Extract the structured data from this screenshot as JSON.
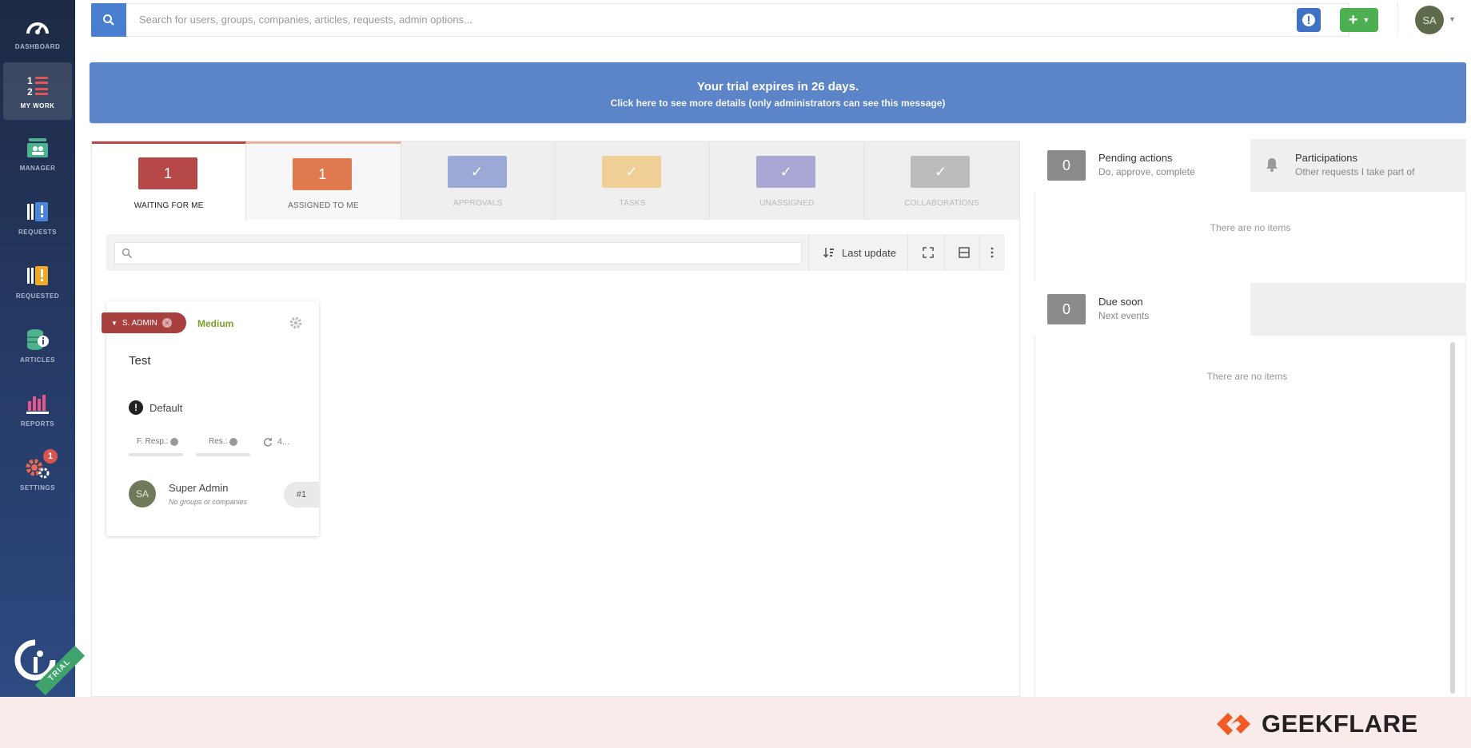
{
  "sidebar": {
    "items": [
      {
        "label": "DASHBOARD",
        "icon": "gauge-icon"
      },
      {
        "label": "MY WORK",
        "icon": "numbered-list-icon"
      },
      {
        "label": "MANAGER",
        "icon": "manager-icon"
      },
      {
        "label": "REQUESTS",
        "icon": "requests-icon"
      },
      {
        "label": "REQUESTED",
        "icon": "requested-icon"
      },
      {
        "label": "ARTICLES",
        "icon": "database-info-icon"
      },
      {
        "label": "REPORTS",
        "icon": "bar-chart-icon"
      },
      {
        "label": "SETTINGS",
        "icon": "gears-icon",
        "badge": "1"
      }
    ],
    "trial_label": "TRIAL"
  },
  "topbar": {
    "search_placeholder": "Search for users, groups, companies, articles, requests, admin options...",
    "avatar_initials": "SA"
  },
  "banner": {
    "line1": "Your trial expires in 26 days.",
    "line2": "Click here to see more details (only administrators can see this message)"
  },
  "tabs": [
    {
      "label": "WAITING FOR ME",
      "value": "1",
      "color": "#b74848"
    },
    {
      "label": "ASSIGNED TO ME",
      "value": "1",
      "color": "#e07a4e"
    },
    {
      "label": "APPROVALS",
      "value": "✓",
      "color": "#9aa9d6"
    },
    {
      "label": "TASKS",
      "value": "✓",
      "color": "#f0cf96"
    },
    {
      "label": "UNASSIGNED",
      "value": "✓",
      "color": "#a9a7d4"
    },
    {
      "label": "COLLABORATIONS",
      "value": "✓",
      "color": "#bcbcbc"
    }
  ],
  "toolbar": {
    "sort_label": "Last update"
  },
  "card": {
    "owner": "S. ADMIN",
    "priority": "Medium",
    "title": "Test",
    "category": "Default",
    "first_response": "F. Resp.:",
    "resolution": "Res.:",
    "updates": "4...",
    "user_initials": "SA",
    "user_name": "Super Admin",
    "user_sub": "No groups or companies",
    "ticket_id": "#1"
  },
  "right": {
    "pending": {
      "count": "0",
      "title": "Pending actions",
      "subtitle": "Do, approve, complete"
    },
    "participations": {
      "title": "Participations",
      "subtitle": "Other requests I take part of"
    },
    "pending_empty": "There are no items",
    "due": {
      "count": "0",
      "title": "Due soon",
      "subtitle": "Next events"
    },
    "due_empty": "There are no items"
  },
  "footer": {
    "brand": "GEEKFLARE"
  }
}
